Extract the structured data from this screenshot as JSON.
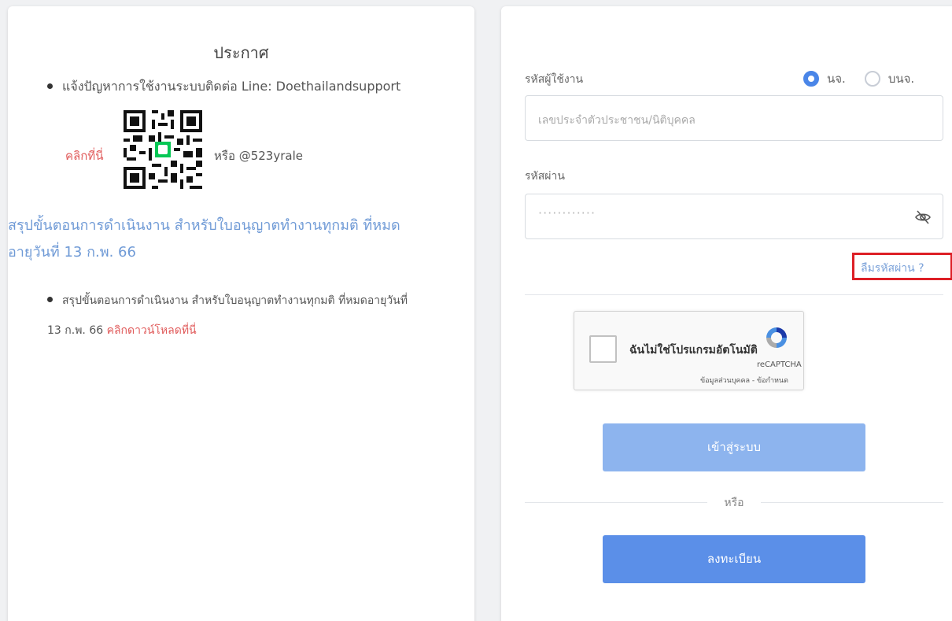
{
  "announcement": {
    "title": "ประกาศ",
    "line_contact": "แจ้งปัญหาการใช้งานระบบติดต่อ Line: Doethailandsupport",
    "click_here": "คลิกที่นี่",
    "or_line_id": "หรือ @523yrale",
    "summary_link": "สรุปขั้นตอนการดำเนินงาน สำหรับใบอนุญาตทำงานทุกมติ ที่หมดอายุวันที่ 13 ก.พ. 66",
    "summary_item": "สรุปขั้นตอนการดำเนินงาน สำหรับใบอนุญาตทำงานทุกมติ ที่หมดอายุวันที่ 13 ก.พ. 66",
    "download_link": "คลิกดาวน์โหลดที่นี่"
  },
  "login": {
    "username_label": "รหัสผู้ใช้งาน",
    "radio_options": [
      {
        "label": "นจ.",
        "selected": true
      },
      {
        "label": "บนจ.",
        "selected": false
      }
    ],
    "username_placeholder": "เลขประจำตัวประชาชน/นิติบุคคล",
    "password_label": "รหัสผ่าน",
    "password_mask": "············",
    "forgot_password": "ลืมรหัสผ่าน ?",
    "recaptcha_text": "ฉันไม่ใช่โปรแกรมอัตโนมัติ",
    "recaptcha_brand": "reCAPTCHA",
    "recaptcha_terms": "ข้อมูลส่วนบุคคล - ข้อกำหนด",
    "login_button": "เข้าสู่ระบบ",
    "or_text": "หรือ",
    "register_button": "ลงทะเบียน"
  },
  "colors": {
    "accent": "#4a86e8",
    "link": "#6f9ad6",
    "alert_red": "#e05a5a",
    "highlight_border": "#dd1f26"
  }
}
